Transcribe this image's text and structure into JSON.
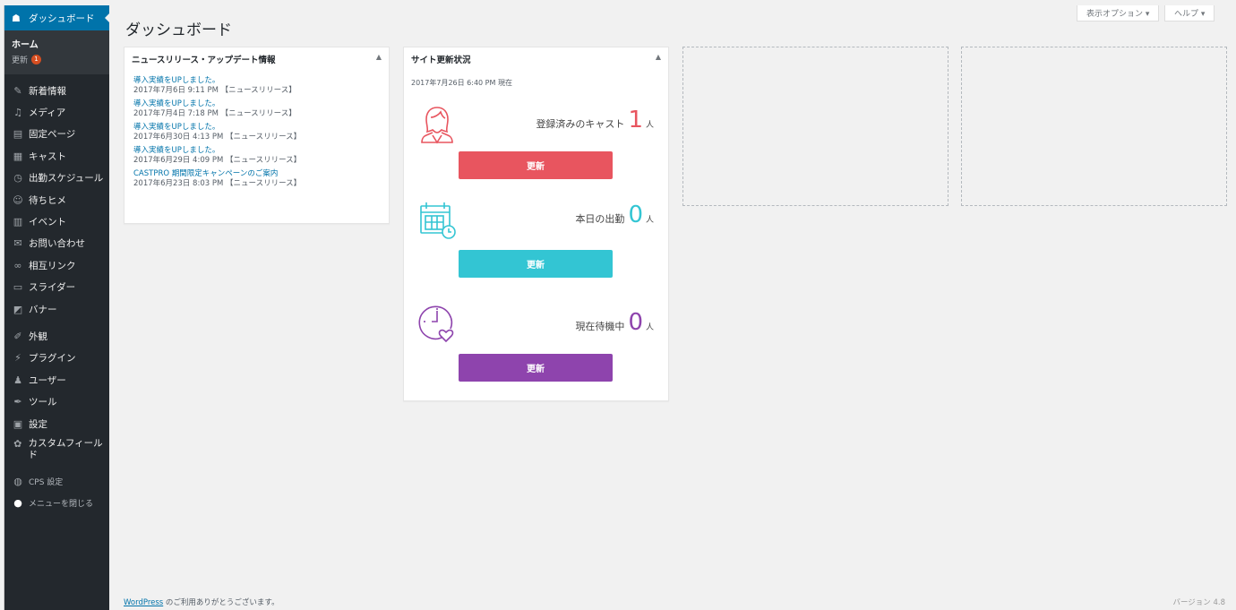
{
  "sidebar": {
    "dashboard": "ダッシュボード",
    "sub_home": "ホーム",
    "sub_updates": "更新",
    "updates_count": "1",
    "items": [
      {
        "label": "新着情報"
      },
      {
        "label": "メディア"
      },
      {
        "label": "固定ページ"
      },
      {
        "label": "キャスト"
      },
      {
        "label": "出勤スケジュール"
      },
      {
        "label": "待ちヒメ"
      },
      {
        "label": "イベント"
      },
      {
        "label": "お問い合わせ"
      },
      {
        "label": "相互リンク"
      },
      {
        "label": "スライダー"
      },
      {
        "label": "バナー"
      }
    ],
    "items2": [
      {
        "label": "外観"
      },
      {
        "label": "プラグイン"
      },
      {
        "label": "ユーザー"
      },
      {
        "label": "ツール"
      },
      {
        "label": "設定"
      },
      {
        "label": "カスタムフィールド"
      }
    ],
    "cps": "CPS 設定",
    "collapse": "メニューを閉じる"
  },
  "header": {
    "title": "ダッシュボード",
    "screen_options": "表示オプション ▾",
    "help": "ヘルプ ▾"
  },
  "news": {
    "title": "ニュースリリース・アップデート情報",
    "toggle": "▲",
    "items": [
      {
        "link": "導入実績をUPしました。",
        "meta": "2017年7月6日 9:11 PM 【ニュースリリース】"
      },
      {
        "link": "導入実績をUPしました。",
        "meta": "2017年7月4日 7:18 PM 【ニュースリリース】"
      },
      {
        "link": "導入実績をUPしました。",
        "meta": "2017年6月30日 4:13 PM 【ニュースリリース】"
      },
      {
        "link": "導入実績をUPしました。",
        "meta": "2017年6月29日 4:09 PM 【ニュースリリース】"
      },
      {
        "link": "CASTPRO 期間限定キャンペーンのご案内",
        "meta": "2017年6月23日 8:03 PM 【ニュースリリース】"
      }
    ]
  },
  "status": {
    "title": "サイト更新状況",
    "toggle": "▲",
    "stamp": "2017年7月26日 6:40 PM 現在",
    "rows": [
      {
        "label": "登録済みのキャスト",
        "value": "1",
        "unit": "人",
        "button": "更新",
        "color": "#e8555f"
      },
      {
        "label": "本日の出勤",
        "value": "0",
        "unit": "人",
        "button": "更新",
        "color": "#33c5d3"
      },
      {
        "label": "現在待機中",
        "value": "0",
        "unit": "人",
        "button": "更新",
        "color": "#8e44ad"
      }
    ]
  },
  "footer": {
    "wordpress": "WordPress",
    "thanks": " のご利用ありがとうございます。",
    "version": "バージョン 4.8"
  },
  "colors": {
    "sidebar_bg": "#23282d",
    "accent": "#0073aa",
    "cast_red": "#e8555f",
    "attend_cyan": "#33c5d3",
    "wait_purple": "#8e44ad"
  }
}
